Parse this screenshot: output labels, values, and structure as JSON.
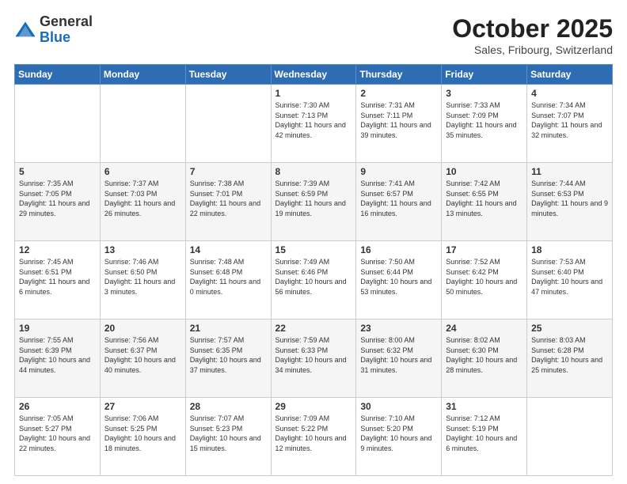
{
  "header": {
    "logo": {
      "general": "General",
      "blue": "Blue"
    },
    "title": "October 2025",
    "location": "Sales, Fribourg, Switzerland"
  },
  "weekdays": [
    "Sunday",
    "Monday",
    "Tuesday",
    "Wednesday",
    "Thursday",
    "Friday",
    "Saturday"
  ],
  "weeks": [
    [
      null,
      null,
      null,
      {
        "day": "1",
        "sunrise": "7:30 AM",
        "sunset": "7:13 PM",
        "daylight": "11 hours and 42 minutes."
      },
      {
        "day": "2",
        "sunrise": "7:31 AM",
        "sunset": "7:11 PM",
        "daylight": "11 hours and 39 minutes."
      },
      {
        "day": "3",
        "sunrise": "7:33 AM",
        "sunset": "7:09 PM",
        "daylight": "11 hours and 35 minutes."
      },
      {
        "day": "4",
        "sunrise": "7:34 AM",
        "sunset": "7:07 PM",
        "daylight": "11 hours and 32 minutes."
      }
    ],
    [
      {
        "day": "5",
        "sunrise": "7:35 AM",
        "sunset": "7:05 PM",
        "daylight": "11 hours and 29 minutes."
      },
      {
        "day": "6",
        "sunrise": "7:37 AM",
        "sunset": "7:03 PM",
        "daylight": "11 hours and 26 minutes."
      },
      {
        "day": "7",
        "sunrise": "7:38 AM",
        "sunset": "7:01 PM",
        "daylight": "11 hours and 22 minutes."
      },
      {
        "day": "8",
        "sunrise": "7:39 AM",
        "sunset": "6:59 PM",
        "daylight": "11 hours and 19 minutes."
      },
      {
        "day": "9",
        "sunrise": "7:41 AM",
        "sunset": "6:57 PM",
        "daylight": "11 hours and 16 minutes."
      },
      {
        "day": "10",
        "sunrise": "7:42 AM",
        "sunset": "6:55 PM",
        "daylight": "11 hours and 13 minutes."
      },
      {
        "day": "11",
        "sunrise": "7:44 AM",
        "sunset": "6:53 PM",
        "daylight": "11 hours and 9 minutes."
      }
    ],
    [
      {
        "day": "12",
        "sunrise": "7:45 AM",
        "sunset": "6:51 PM",
        "daylight": "11 hours and 6 minutes."
      },
      {
        "day": "13",
        "sunrise": "7:46 AM",
        "sunset": "6:50 PM",
        "daylight": "11 hours and 3 minutes."
      },
      {
        "day": "14",
        "sunrise": "7:48 AM",
        "sunset": "6:48 PM",
        "daylight": "11 hours and 0 minutes."
      },
      {
        "day": "15",
        "sunrise": "7:49 AM",
        "sunset": "6:46 PM",
        "daylight": "10 hours and 56 minutes."
      },
      {
        "day": "16",
        "sunrise": "7:50 AM",
        "sunset": "6:44 PM",
        "daylight": "10 hours and 53 minutes."
      },
      {
        "day": "17",
        "sunrise": "7:52 AM",
        "sunset": "6:42 PM",
        "daylight": "10 hours and 50 minutes."
      },
      {
        "day": "18",
        "sunrise": "7:53 AM",
        "sunset": "6:40 PM",
        "daylight": "10 hours and 47 minutes."
      }
    ],
    [
      {
        "day": "19",
        "sunrise": "7:55 AM",
        "sunset": "6:39 PM",
        "daylight": "10 hours and 44 minutes."
      },
      {
        "day": "20",
        "sunrise": "7:56 AM",
        "sunset": "6:37 PM",
        "daylight": "10 hours and 40 minutes."
      },
      {
        "day": "21",
        "sunrise": "7:57 AM",
        "sunset": "6:35 PM",
        "daylight": "10 hours and 37 minutes."
      },
      {
        "day": "22",
        "sunrise": "7:59 AM",
        "sunset": "6:33 PM",
        "daylight": "10 hours and 34 minutes."
      },
      {
        "day": "23",
        "sunrise": "8:00 AM",
        "sunset": "6:32 PM",
        "daylight": "10 hours and 31 minutes."
      },
      {
        "day": "24",
        "sunrise": "8:02 AM",
        "sunset": "6:30 PM",
        "daylight": "10 hours and 28 minutes."
      },
      {
        "day": "25",
        "sunrise": "8:03 AM",
        "sunset": "6:28 PM",
        "daylight": "10 hours and 25 minutes."
      }
    ],
    [
      {
        "day": "26",
        "sunrise": "7:05 AM",
        "sunset": "5:27 PM",
        "daylight": "10 hours and 22 minutes."
      },
      {
        "day": "27",
        "sunrise": "7:06 AM",
        "sunset": "5:25 PM",
        "daylight": "10 hours and 18 minutes."
      },
      {
        "day": "28",
        "sunrise": "7:07 AM",
        "sunset": "5:23 PM",
        "daylight": "10 hours and 15 minutes."
      },
      {
        "day": "29",
        "sunrise": "7:09 AM",
        "sunset": "5:22 PM",
        "daylight": "10 hours and 12 minutes."
      },
      {
        "day": "30",
        "sunrise": "7:10 AM",
        "sunset": "5:20 PM",
        "daylight": "10 hours and 9 minutes."
      },
      {
        "day": "31",
        "sunrise": "7:12 AM",
        "sunset": "5:19 PM",
        "daylight": "10 hours and 6 minutes."
      },
      null
    ]
  ]
}
